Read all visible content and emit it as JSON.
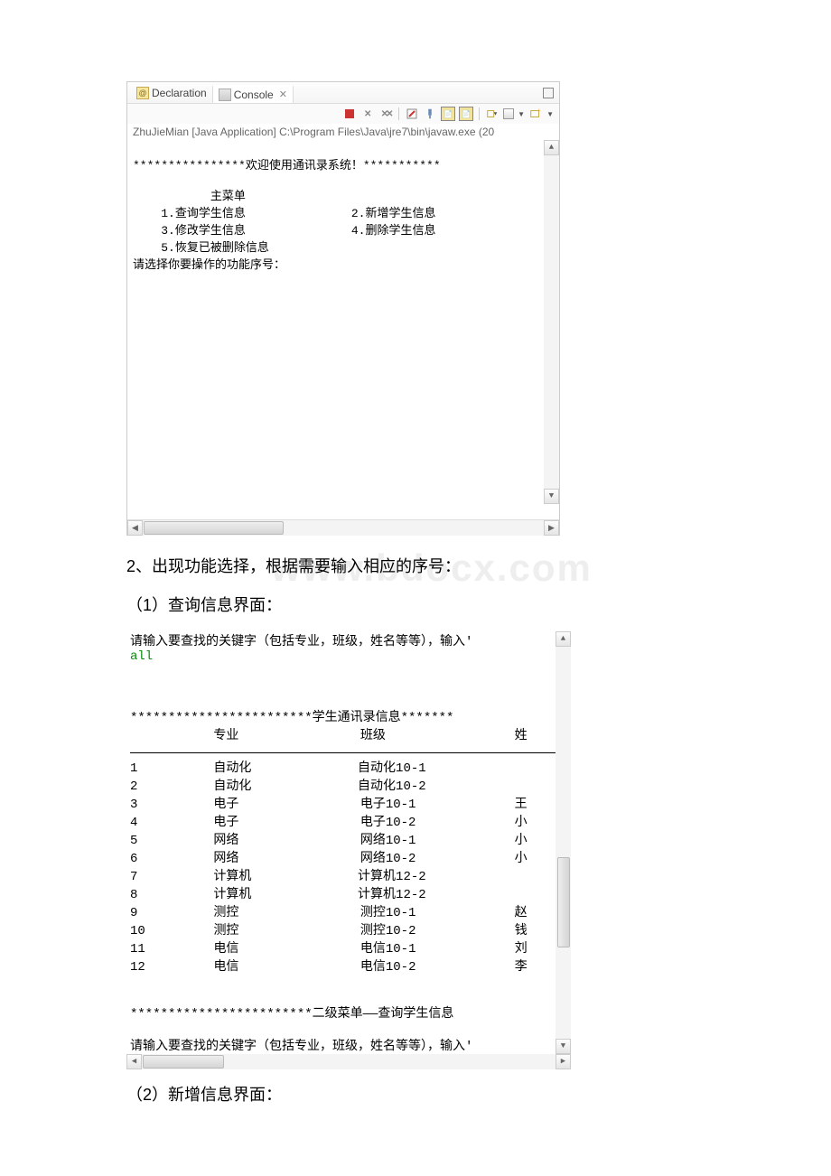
{
  "tabs": {
    "declaration": "Declaration",
    "console": "Console"
  },
  "console_info": "ZhuJieMian [Java Application] C:\\Program Files\\Java\\jre7\\bin\\javaw.exe (20",
  "menu": {
    "welcome": "****************欢迎使用通讯录系统！***********",
    "title": "主菜单",
    "item1": "1.查询学生信息",
    "item2": "2.新增学生信息",
    "item3": "3.修改学生信息",
    "item4": "4.删除学生信息",
    "item5": "5.恢复已被删除信息",
    "prompt": "请选择你要操作的功能序号："
  },
  "doc": {
    "line2": "2、出现功能选择，根据需要输入相应的序号：",
    "line3": "（1）查询信息界面：",
    "line4": "（2）新增信息界面："
  },
  "query": {
    "prompt1": "请输入要查找的关键字（包括专业，班级，姓名等等），输入'",
    "input": "all",
    "header_stars": "************************学生通讯录信息*******",
    "col_major": "专业",
    "col_class": "班级",
    "col_name": "姓",
    "rows": [
      {
        "n": "1",
        "major": "自动化",
        "class": "自动化10-1",
        "name": ""
      },
      {
        "n": "2",
        "major": "自动化",
        "class": "自动化10-2",
        "name": ""
      },
      {
        "n": "3",
        "major": "电子",
        "class": "电子10-1",
        "name": "王"
      },
      {
        "n": "4",
        "major": "电子",
        "class": "电子10-2",
        "name": "小"
      },
      {
        "n": "5",
        "major": "网络",
        "class": "网络10-1",
        "name": "小"
      },
      {
        "n": "6",
        "major": "网络",
        "class": "网络10-2",
        "name": "小"
      },
      {
        "n": "7",
        "major": "计算机",
        "class": "计算机12-2",
        "name": ""
      },
      {
        "n": "8",
        "major": "计算机",
        "class": "计算机12-2",
        "name": ""
      },
      {
        "n": "9",
        "major": "测控",
        "class": "测控10-1",
        "name": "赵"
      },
      {
        "n": "10",
        "major": "测控",
        "class": "测控10-2",
        "name": "钱"
      },
      {
        "n": "11",
        "major": "电信",
        "class": "电信10-1",
        "name": "刘"
      },
      {
        "n": "12",
        "major": "电信",
        "class": "电信10-2",
        "name": "李"
      }
    ],
    "sub_menu": "************************二级菜单——查询学生信息",
    "prompt2": "请输入要查找的关键字（包括专业，班级，姓名等等），输入'"
  },
  "watermark": "www.bdocx.com"
}
